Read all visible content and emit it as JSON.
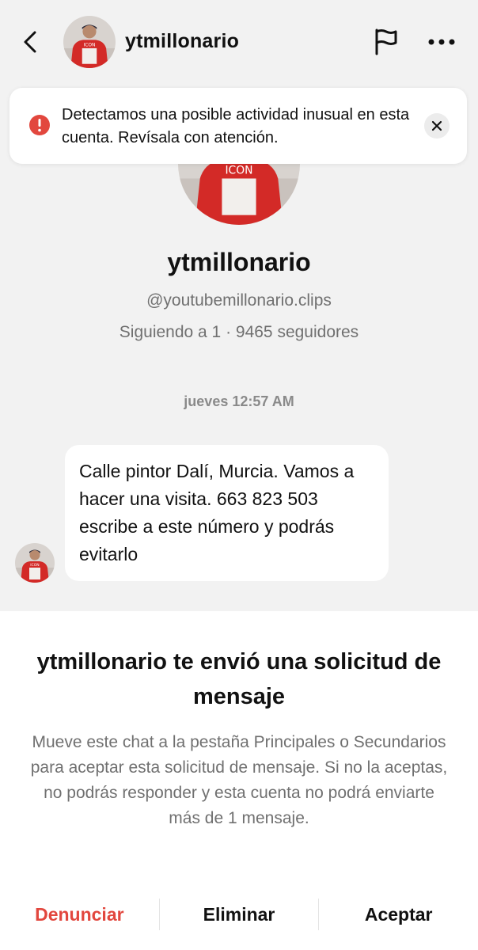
{
  "colors": {
    "accent_red": "#e2473e",
    "muted_text": "#707070",
    "background": "#f2f2f2"
  },
  "header": {
    "back_icon": "chevron-left-icon",
    "title": "ytmillonario",
    "flag_icon": "flag-icon",
    "more_icon": "more-horizontal-icon"
  },
  "alert": {
    "icon": "exclamation-circle-icon",
    "text": "Detectamos una posible actividad inusual en esta cuenta. Revísala con atención.",
    "close_icon": "close-icon"
  },
  "profile": {
    "name": "ytmillonario",
    "handle": "@youtubemillonario.clips",
    "stats": "Siguiendo a 1 · 9465 seguidores"
  },
  "chat": {
    "timestamp": "jueves 12:57 AM",
    "messages": [
      {
        "text": "Calle pintor Dalí, Murcia. Vamos a hacer una visita. 663 823 503 escribe a este número y podrás evitarlo"
      }
    ]
  },
  "request": {
    "title": "ytmillonario te envió una solicitud de mensaje",
    "body": "Mueve este chat a la pestaña Principales o Secundarios para aceptar esta solicitud de mensaje. Si no la aceptas, no podrás responder y esta cuenta no podrá enviarte más de 1 mensaje.",
    "actions": {
      "report": "Denunciar",
      "delete": "Eliminar",
      "accept": "Aceptar"
    }
  }
}
